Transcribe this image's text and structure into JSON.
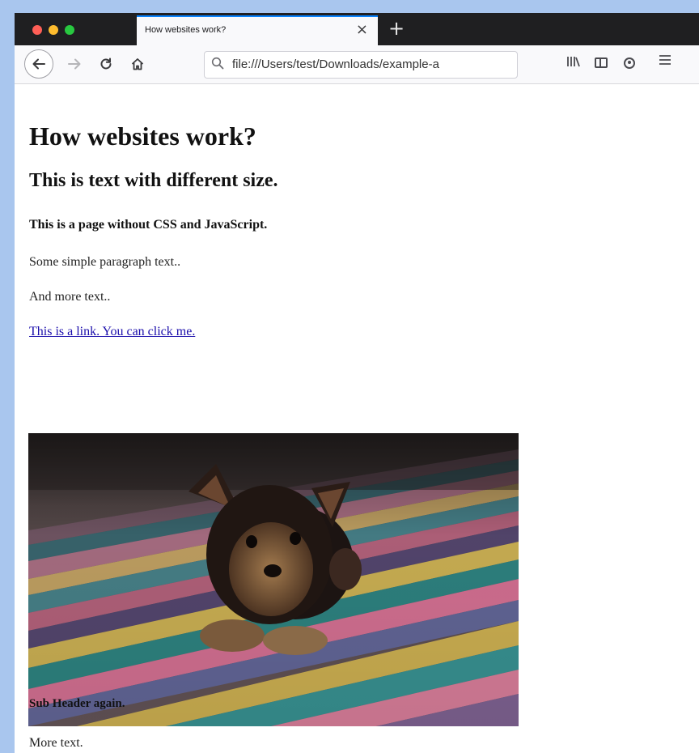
{
  "browser": {
    "tab_title": "How websites work?",
    "tab_close": "×",
    "new_tab": "+",
    "url": "file:///Users/test/Downloads/example-a",
    "icons": [
      "back-arrow-icon",
      "forward-arrow-icon",
      "reload-icon",
      "home-icon",
      "search-icon",
      "library-icon",
      "sidebar-icon",
      "account-icon",
      "menu-icon"
    ],
    "accent": "#0a84ff"
  },
  "page": {
    "h1": "How websites work?",
    "h2": "This is text with different size.",
    "h3": "This is a page without CSS and JavaScript.",
    "p1": "Some simple paragraph text..",
    "p2": "And more text..",
    "link": "This is a link. You can click me.",
    "image_alt": "puppy on a colorful rug",
    "sub_header": "Sub Header again.",
    "p3": "More text."
  }
}
